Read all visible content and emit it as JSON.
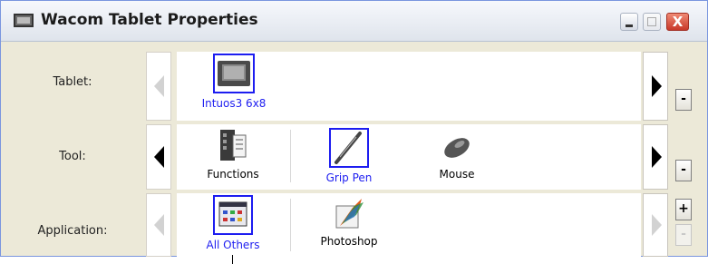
{
  "window": {
    "title": "Wacom Tablet Properties",
    "close_glyph": "X"
  },
  "rows": {
    "tablet": {
      "label": "Tablet:",
      "items": [
        {
          "name": "Intuos3 6x8",
          "icon": "tablet-icon",
          "selected": true
        }
      ],
      "remove_label": "-"
    },
    "tool": {
      "label": "Tool:",
      "items": [
        {
          "name": "Functions",
          "icon": "functions-icon",
          "selected": false
        },
        {
          "name": "Grip Pen",
          "icon": "pen-icon",
          "selected": true
        },
        {
          "name": "Mouse",
          "icon": "mouse-icon",
          "selected": false
        }
      ],
      "remove_label": "-"
    },
    "application": {
      "label": "Application:",
      "items": [
        {
          "name": "All Others",
          "icon": "all-others-icon",
          "selected": true
        },
        {
          "name": "Photoshop",
          "icon": "photoshop-icon",
          "selected": false
        }
      ],
      "add_label": "+",
      "remove_label": "-"
    }
  },
  "colors": {
    "selection": "#1d1df0",
    "close_button": "#c8382a"
  }
}
